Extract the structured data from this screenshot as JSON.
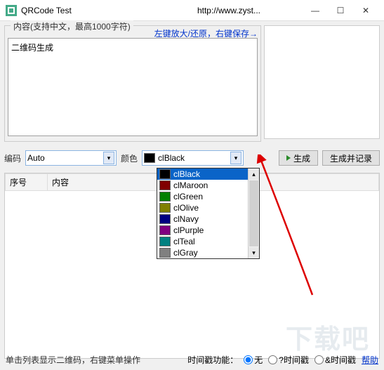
{
  "window": {
    "title": "QRCode Test",
    "url": "http://www.zyst..."
  },
  "content_group": {
    "legend": "内容(支持中文，最高1000字符)",
    "hint": "左键放大/还原，右键保存→",
    "textarea_value": "二维码生成"
  },
  "controls": {
    "encoding_label": "编码",
    "encoding_value": "Auto",
    "color_label": "颜色",
    "color_value": "clBlack",
    "generate_btn": "生成",
    "generate_record_btn": "生成并记录"
  },
  "table": {
    "col_seq": "序号",
    "col_content": "内容"
  },
  "color_dropdown": [
    {
      "name": "clBlack",
      "hex": "#000000",
      "sel": true
    },
    {
      "name": "clMaroon",
      "hex": "#800000"
    },
    {
      "name": "clGreen",
      "hex": "#008000"
    },
    {
      "name": "clOlive",
      "hex": "#808000"
    },
    {
      "name": "clNavy",
      "hex": "#000080"
    },
    {
      "name": "clPurple",
      "hex": "#800080"
    },
    {
      "name": "clTeal",
      "hex": "#008080"
    },
    {
      "name": "clGray",
      "hex": "#808080"
    }
  ],
  "footer": {
    "hint": "单击列表显示二维码，右键菜单操作",
    "timestamp_label": "时间戳功能：",
    "opt_none": "无",
    "opt_q": "?时间戳",
    "opt_amp": "&时间戳",
    "help": "帮助"
  },
  "watermark": "下载吧"
}
